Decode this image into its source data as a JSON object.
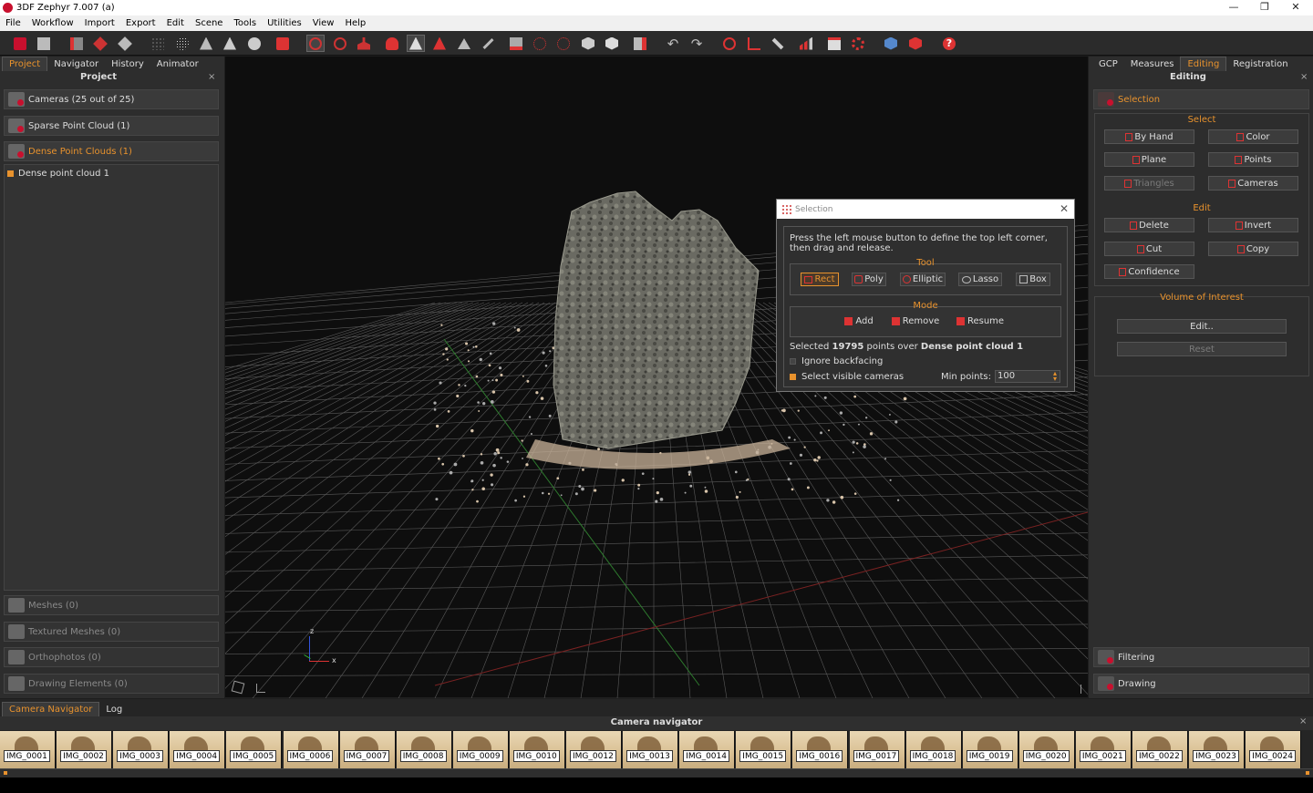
{
  "window": {
    "title": "3DF Zephyr 7.007 (a)",
    "controls": [
      "—",
      "❐",
      "✕"
    ]
  },
  "menu": [
    "File",
    "Workflow",
    "Import",
    "Export",
    "Edit",
    "Scene",
    "Tools",
    "Utilities",
    "View",
    "Help"
  ],
  "left_panel": {
    "tabs": [
      "Project",
      "Navigator",
      "History",
      "Animator"
    ],
    "active_tab": "Project",
    "title": "Project",
    "close": "×",
    "sections": [
      {
        "label": "Cameras (25 out of 25)"
      },
      {
        "label": "Sparse Point Cloud (1)"
      },
      {
        "label": "Dense Point Clouds (1)"
      }
    ],
    "dense_item": "Dense point cloud 1",
    "disabled_sections": [
      {
        "label": "Meshes (0)"
      },
      {
        "label": "Textured Meshes (0)"
      },
      {
        "label": "Orthophotos (0)"
      },
      {
        "label": "Drawing Elements (0)"
      }
    ]
  },
  "right_panel": {
    "tabs": [
      "GCP",
      "Measures",
      "Editing",
      "Registration"
    ],
    "active_tab": "Editing",
    "title": "Editing",
    "close": "×",
    "selection_header": "Selection",
    "select_label": "Select",
    "select_buttons": [
      "By Hand",
      "Color",
      "Plane",
      "Points",
      "Triangles",
      "Cameras"
    ],
    "edit_label": "Edit",
    "edit_buttons": [
      "Delete",
      "Invert",
      "Cut",
      "Copy",
      "Confidence"
    ],
    "voi_label": "Volume of Interest",
    "voi_edit": "Edit..",
    "voi_reset": "Reset",
    "filtering": "Filtering",
    "drawing": "Drawing"
  },
  "dialog": {
    "title": "Selection",
    "close": "✕",
    "instructions": "Press the left mouse button to define the top left corner, then drag and release.",
    "tool_label": "Tool",
    "tools": [
      "Rect",
      "Poly",
      "Elliptic",
      "Lasso",
      "Box"
    ],
    "mode_label": "Mode",
    "modes": [
      "Add",
      "Remove",
      "Resume"
    ],
    "selected_prefix": "Selected",
    "selected_count": "19795",
    "selected_mid": "points over",
    "selected_target": "Dense point cloud 1",
    "ignore_backfacing": "Ignore backfacing",
    "select_visible": "Select visible cameras",
    "min_points_label": "Min points:",
    "min_points_value": "100"
  },
  "axes": {
    "z": "z",
    "x": "x"
  },
  "bottom": {
    "tabs": [
      "Camera Navigator",
      "Log"
    ],
    "active_tab": "Camera Navigator",
    "title": "Camera navigator",
    "close": "×",
    "images": [
      "IMG_0001",
      "IMG_0002",
      "IMG_0003",
      "IMG_0004",
      "IMG_0005",
      "IMG_0006",
      "IMG_0007",
      "IMG_0008",
      "IMG_0009",
      "IMG_0010",
      "IMG_0012",
      "IMG_0013",
      "IMG_0014",
      "IMG_0015",
      "IMG_0016",
      "IMG_0017",
      "IMG_0018",
      "IMG_0019",
      "IMG_0020",
      "IMG_0021",
      "IMG_0022",
      "IMG_0023",
      "IMG_0024"
    ]
  },
  "colors": {
    "accent": "#e8922d",
    "brand_red": "#c8102e"
  }
}
